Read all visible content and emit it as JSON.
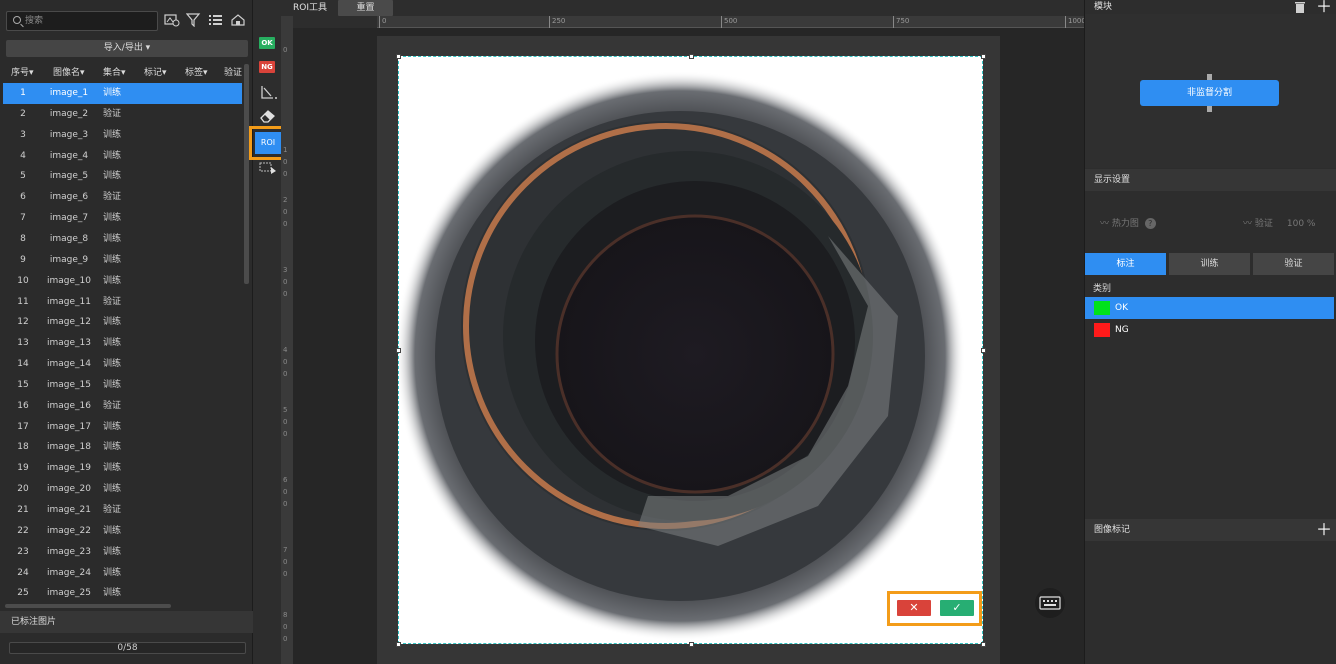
{
  "left_panel": {
    "search_placeholder": "搜索",
    "import_export": "导入/导出 ▾",
    "columns": [
      "序号▾",
      "图像名▾",
      "集合▾",
      "标记▾",
      "标签▾",
      "验证"
    ],
    "rows": [
      {
        "idx": "1",
        "name": "image_1",
        "set": "训练"
      },
      {
        "idx": "2",
        "name": "image_2",
        "set": "验证"
      },
      {
        "idx": "3",
        "name": "image_3",
        "set": "训练"
      },
      {
        "idx": "4",
        "name": "image_4",
        "set": "训练"
      },
      {
        "idx": "5",
        "name": "image_5",
        "set": "训练"
      },
      {
        "idx": "6",
        "name": "image_6",
        "set": "验证"
      },
      {
        "idx": "7",
        "name": "image_7",
        "set": "训练"
      },
      {
        "idx": "8",
        "name": "image_8",
        "set": "训练"
      },
      {
        "idx": "9",
        "name": "image_9",
        "set": "训练"
      },
      {
        "idx": "10",
        "name": "image_10",
        "set": "训练"
      },
      {
        "idx": "11",
        "name": "image_11",
        "set": "验证"
      },
      {
        "idx": "12",
        "name": "image_12",
        "set": "训练"
      },
      {
        "idx": "13",
        "name": "image_13",
        "set": "训练"
      },
      {
        "idx": "14",
        "name": "image_14",
        "set": "训练"
      },
      {
        "idx": "15",
        "name": "image_15",
        "set": "训练"
      },
      {
        "idx": "16",
        "name": "image_16",
        "set": "验证"
      },
      {
        "idx": "17",
        "name": "image_17",
        "set": "训练"
      },
      {
        "idx": "18",
        "name": "image_18",
        "set": "训练"
      },
      {
        "idx": "19",
        "name": "image_19",
        "set": "训练"
      },
      {
        "idx": "20",
        "name": "image_20",
        "set": "训练"
      },
      {
        "idx": "21",
        "name": "image_21",
        "set": "验证"
      },
      {
        "idx": "22",
        "name": "image_22",
        "set": "训练"
      },
      {
        "idx": "23",
        "name": "image_23",
        "set": "训练"
      },
      {
        "idx": "24",
        "name": "image_24",
        "set": "训练"
      },
      {
        "idx": "25",
        "name": "image_25",
        "set": "训练"
      }
    ],
    "labeled_images": "已标注图片",
    "progress": "0/58"
  },
  "tools": {
    "ok_badge": "OK",
    "ng_badge": "NG",
    "roi_label": "ROI"
  },
  "tabs": {
    "roi_tool": "ROI工具",
    "reset": "重置"
  },
  "ruler": {
    "h_ticks": [
      "0",
      "250",
      "500",
      "750",
      "1000"
    ]
  },
  "right_panel": {
    "module_title": "模块",
    "module_node": "非监督分割",
    "display_settings": "显示设置",
    "heatmap": "热力图",
    "verify_label": "验证",
    "verify_value": "100 %",
    "segments": [
      "标注",
      "训练",
      "验证"
    ],
    "class_label": "类别",
    "classes": [
      {
        "name": "OK",
        "color": "#00e21b"
      },
      {
        "name": "NG",
        "color": "#ff1a1a"
      }
    ],
    "image_marks": "图像标记"
  },
  "colors": {
    "accent": "#2f8ef2",
    "highlight": "#f39c19",
    "ok": "#27ae73",
    "cancel": "#d9433a"
  }
}
